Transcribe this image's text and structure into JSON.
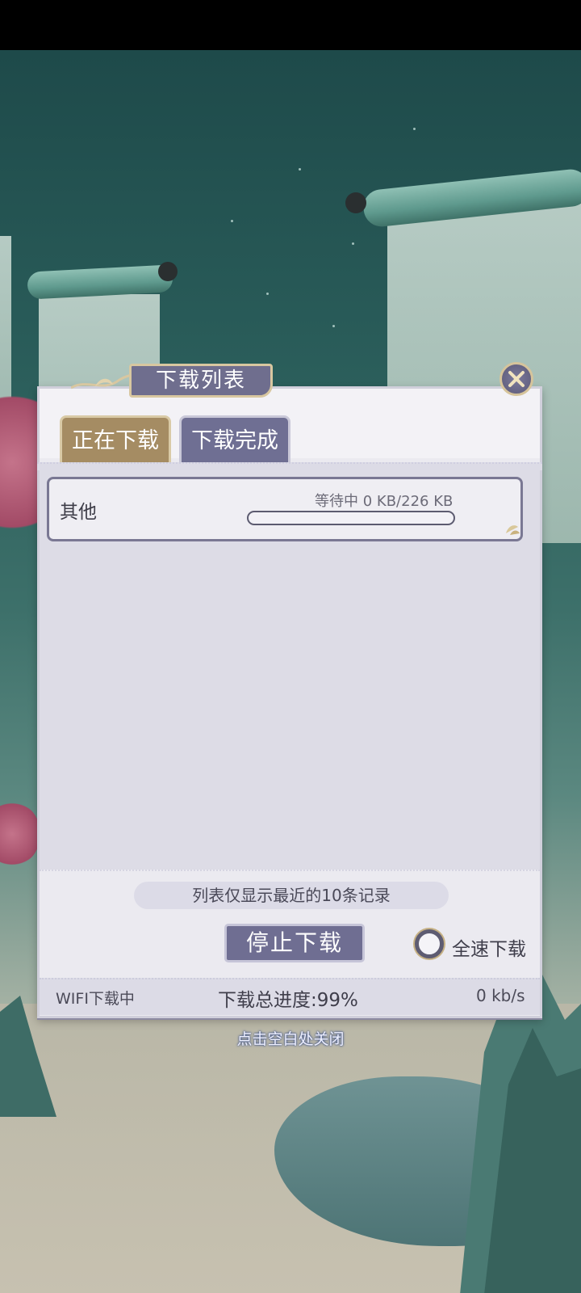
{
  "dialog": {
    "title": "下载列表",
    "tabs": [
      {
        "label": "正在下载",
        "active": true
      },
      {
        "label": "下载完成",
        "active": false
      }
    ],
    "items": [
      {
        "name": "其他",
        "status": "等待中 0 KB/226 KB",
        "progress": 0
      }
    ],
    "notice": "列表仅显示最近的10条记录",
    "stop_button": "停止下载",
    "fullspeed_label": "全速下载",
    "fullspeed_enabled": false,
    "wifi_status": "WIFI下载中",
    "total_progress": "下载总进度:99%",
    "speed": "0 kb/s"
  },
  "close_hint": "点击空白处关闭",
  "colors": {
    "tab_active": "#a58c63",
    "tab_inactive": "#6f6f93",
    "button": "#6f6e92",
    "panel": "#ebeaf0"
  },
  "icons": {
    "close": "close-x-icon",
    "ornament": "lotus-ornament-icon"
  }
}
